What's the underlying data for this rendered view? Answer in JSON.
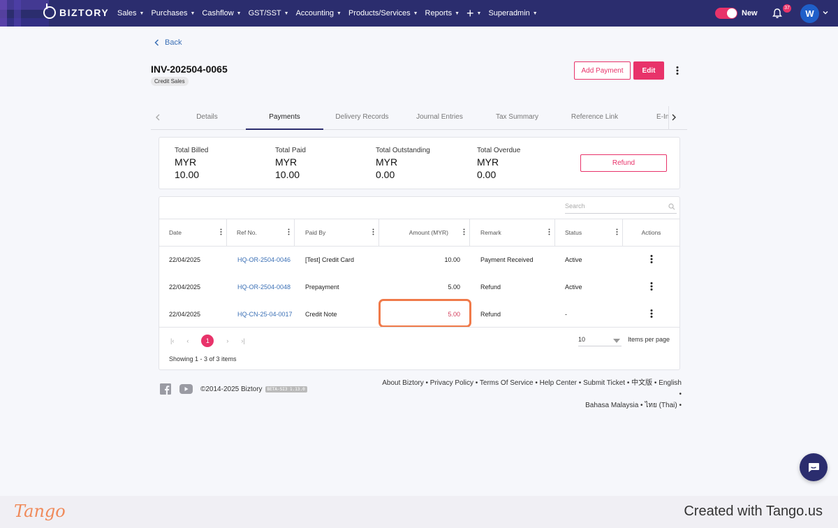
{
  "nav": {
    "brand": "BIZTORY",
    "menu": [
      {
        "label": "Sales"
      },
      {
        "label": "Purchases"
      },
      {
        "label": "Cashflow"
      },
      {
        "label": "GST/SST"
      },
      {
        "label": "Accounting"
      },
      {
        "label": "Products/Services"
      },
      {
        "label": "Reports"
      }
    ],
    "plus": "+",
    "superadmin": "Superadmin",
    "toggle_label": "New",
    "notification_count": "37",
    "avatar_initial": "W",
    "accent": "#e8336a",
    "bar_color": "#2b2d6e"
  },
  "header": {
    "back_label": "Back",
    "invoice_no": "INV-202504-0065",
    "tag": "Credit Sales",
    "add_payment_label": "Add Payment",
    "edit_label": "Edit"
  },
  "tabs": [
    {
      "label": "Details"
    },
    {
      "label": "Payments",
      "active": true
    },
    {
      "label": "Delivery Records"
    },
    {
      "label": "Journal Entries"
    },
    {
      "label": "Tax Summary"
    },
    {
      "label": "Reference Link"
    },
    {
      "label": "E-Inv"
    }
  ],
  "summary": {
    "items": [
      {
        "label": "Total Billed",
        "currency": "MYR",
        "value": "10.00"
      },
      {
        "label": "Total Paid",
        "currency": "MYR",
        "value": "10.00"
      },
      {
        "label": "Total Outstanding",
        "currency": "MYR",
        "value": "0.00"
      },
      {
        "label": "Total Overdue",
        "currency": "MYR",
        "value": "0.00"
      }
    ],
    "refund_label": "Refund"
  },
  "table": {
    "search_placeholder": "Search",
    "columns": [
      "Date",
      "Ref No.",
      "Paid By",
      "Amount (MYR)",
      "Remark",
      "Status",
      "Actions"
    ],
    "rows": [
      {
        "date": "22/04/2025",
        "ref": "HQ-OR-2504-0046",
        "paid_by": "[Test] Credit Card",
        "amount": "10.00",
        "remark": "Payment Received",
        "status": "Active"
      },
      {
        "date": "22/04/2025",
        "ref": "HQ-OR-2504-0048",
        "paid_by": "Prepayment",
        "amount": "5.00",
        "remark": "Refund",
        "status": "Active"
      },
      {
        "date": "22/04/2025",
        "ref": "HQ-CN-25-04-0017",
        "paid_by": "Credit Note",
        "amount": "5.00",
        "remark": "Refund",
        "status": "-"
      }
    ],
    "current_page": "1",
    "items_per_page": "10",
    "items_per_page_label": "Items per page",
    "showing": "Showing 1 - 3 of 3 items"
  },
  "footer": {
    "copyright": "©2014-2025 Biztory",
    "beta": "BETA-SI3 1.13.0",
    "links_line1": "About Biztory • Privacy Policy • Terms Of Service • Help Center • Submit Ticket • 中文版 • English •",
    "links_line2": "Bahasa Malaysia • ไทย (Thai) •"
  },
  "tango": {
    "logo": "Tango",
    "text": "Created with Tango.us"
  }
}
